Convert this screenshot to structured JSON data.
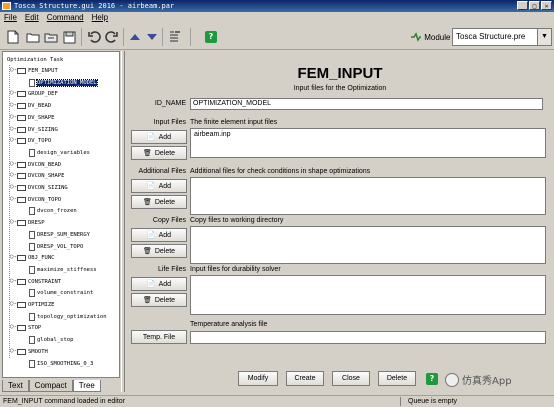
{
  "window": {
    "title": "Tosca Structure.gui 2016 - airbeam.par"
  },
  "menu": [
    "File",
    "Edit",
    "Command",
    "Help"
  ],
  "toolbar": {
    "icons": [
      "new-file-icon",
      "open-folder-icon",
      "open-recent-icon",
      "save-icon",
      "undo-icon",
      "redo-icon",
      "move-up-icon",
      "move-down-icon",
      "edit-list-icon",
      "help-icon"
    ],
    "module_label": "Module",
    "module_value": "Tosca Structure.pre"
  },
  "tree": {
    "root": "Optimization Task",
    "items": [
      {
        "label": "FEM_INPUT",
        "type": "folder",
        "level": 1
      },
      {
        "label": "OPTIMIZATION_MODEL",
        "type": "doc",
        "level": 2,
        "selected": true
      },
      {
        "label": "GROUP_DEF",
        "type": "folder",
        "level": 1
      },
      {
        "label": "DV_BEAD",
        "type": "folder",
        "level": 1
      },
      {
        "label": "DV_SHAPE",
        "type": "folder",
        "level": 1
      },
      {
        "label": "DV_SIZING",
        "type": "folder",
        "level": 1
      },
      {
        "label": "DV_TOPO",
        "type": "folder",
        "level": 1
      },
      {
        "label": "design_variables",
        "type": "doc",
        "level": 2
      },
      {
        "label": "DVCON_BEAD",
        "type": "folder",
        "level": 1
      },
      {
        "label": "DVCON_SHAPE",
        "type": "folder",
        "level": 1
      },
      {
        "label": "DVCON_SIZING",
        "type": "folder",
        "level": 1
      },
      {
        "label": "DVCON_TOPO",
        "type": "folder",
        "level": 1
      },
      {
        "label": "dvcon_frozen",
        "type": "doc",
        "level": 2
      },
      {
        "label": "DRESP",
        "type": "folder",
        "level": 1
      },
      {
        "label": "DRESP_SUM_ENERGY",
        "type": "doc",
        "level": 2
      },
      {
        "label": "DRESP_VOL_TOPO",
        "type": "doc",
        "level": 2
      },
      {
        "label": "OBJ_FUNC",
        "type": "folder",
        "level": 1
      },
      {
        "label": "maximize_stiffness",
        "type": "doc",
        "level": 2
      },
      {
        "label": "CONSTRAINT",
        "type": "folder",
        "level": 1
      },
      {
        "label": "volume_constraint",
        "type": "doc",
        "level": 2
      },
      {
        "label": "OPTIMIZE",
        "type": "folder",
        "level": 1
      },
      {
        "label": "topology_optimization",
        "type": "doc",
        "level": 2
      },
      {
        "label": "STOP",
        "type": "folder",
        "level": 1
      },
      {
        "label": "global_stop",
        "type": "doc",
        "level": 2
      },
      {
        "label": "SMOOTH",
        "type": "folder",
        "level": 1
      },
      {
        "label": "ISO_SMOOTHING_0_3",
        "type": "doc",
        "level": 2
      }
    ]
  },
  "tabs": [
    "Text",
    "Compact",
    "Tree"
  ],
  "active_tab": "Tree",
  "main": {
    "title": "FEM_INPUT",
    "subtitle": "Input files for the Optimization",
    "id_name_label": "ID_NAME",
    "id_name_value": "OPTIMIZATION_MODEL",
    "sections": [
      {
        "label": "Input Files",
        "desc": "The finite element input files",
        "files": [
          "airbeam.inp"
        ]
      },
      {
        "label": "Additional Files",
        "desc": "Additional files for check conditions in shape optimizations",
        "files": []
      },
      {
        "label": "Copy Files",
        "desc": "Copy files to working directory",
        "files": []
      },
      {
        "label": "Life Files",
        "desc": "Input files for durability solver",
        "files": []
      }
    ],
    "add_label": "Add",
    "delete_label": "Delete",
    "temp_desc": "Temperature analysis file",
    "temp_button": "Temp. File",
    "temp_value": "",
    "actions": [
      "Modify",
      "Create",
      "Close",
      "Delete"
    ]
  },
  "status": {
    "left": "FEM_INPUT command loaded in editor",
    "right": "Queue is empty"
  },
  "watermark": "仿真秀App",
  "colors": {
    "selection": "#0a246a",
    "help_green": "#1c9a3c",
    "module_icon": "#2e7d32"
  }
}
